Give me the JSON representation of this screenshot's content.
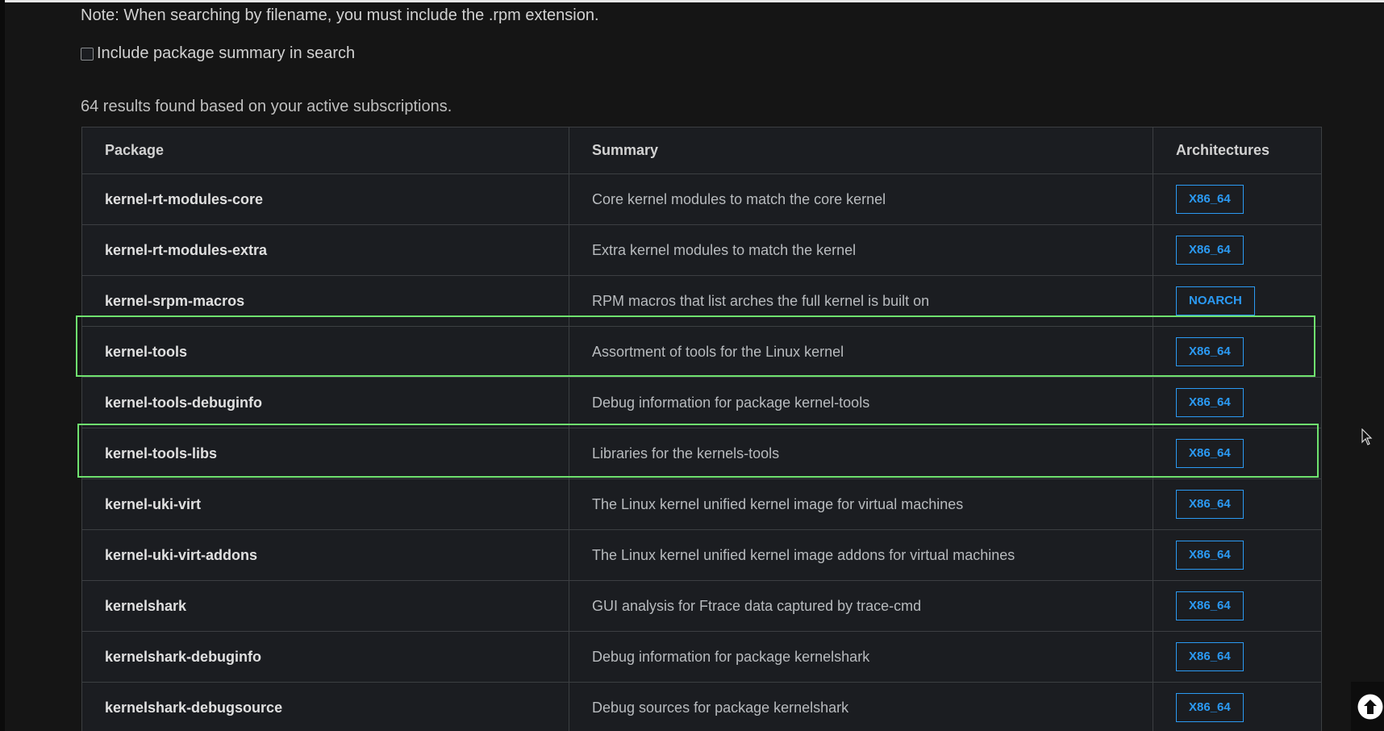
{
  "note": "Note: When searching by filename, you must include the .rpm extension.",
  "summary_option": {
    "label": "Include package summary in search",
    "checked": false
  },
  "results_text": "64 results found based on your active subscriptions.",
  "table": {
    "headers": {
      "package": "Package",
      "summary": "Summary",
      "architectures": "Architectures"
    },
    "rows": [
      {
        "package": "kernel-rt-modules-core",
        "summary": "Core kernel modules to match the core kernel",
        "arch": "X86_64"
      },
      {
        "package": "kernel-rt-modules-extra",
        "summary": "Extra kernel modules to match the kernel",
        "arch": "X86_64"
      },
      {
        "package": "kernel-srpm-macros",
        "summary": "RPM macros that list arches the full kernel is built on",
        "arch": "NOARCH"
      },
      {
        "package": "kernel-tools",
        "summary": "Assortment of tools for the Linux kernel",
        "arch": "X86_64"
      },
      {
        "package": "kernel-tools-debuginfo",
        "summary": "Debug information for package kernel-tools",
        "arch": "X86_64"
      },
      {
        "package": "kernel-tools-libs",
        "summary": "Libraries for the kernels-tools",
        "arch": "X86_64"
      },
      {
        "package": "kernel-uki-virt",
        "summary": "The Linux kernel unified kernel image for virtual machines",
        "arch": "X86_64"
      },
      {
        "package": "kernel-uki-virt-addons",
        "summary": "The Linux kernel unified kernel image addons for virtual machines",
        "arch": "X86_64"
      },
      {
        "package": "kernelshark",
        "summary": "GUI analysis for Ftrace data captured by trace-cmd",
        "arch": "X86_64"
      },
      {
        "package": "kernelshark-debuginfo",
        "summary": "Debug information for package kernelshark",
        "arch": "X86_64"
      },
      {
        "package": "kernelshark-debugsource",
        "summary": "Debug sources for package kernelshark",
        "arch": "X86_64"
      }
    ]
  },
  "colors": {
    "background": "#151515",
    "table_background": "#1b1d21",
    "badge_blue": "#2b9af3",
    "highlight_green": "#6fe26f"
  },
  "icons": {
    "scroll_top": "arrow-up-circle-icon",
    "cursor": "mouse-pointer-icon"
  }
}
